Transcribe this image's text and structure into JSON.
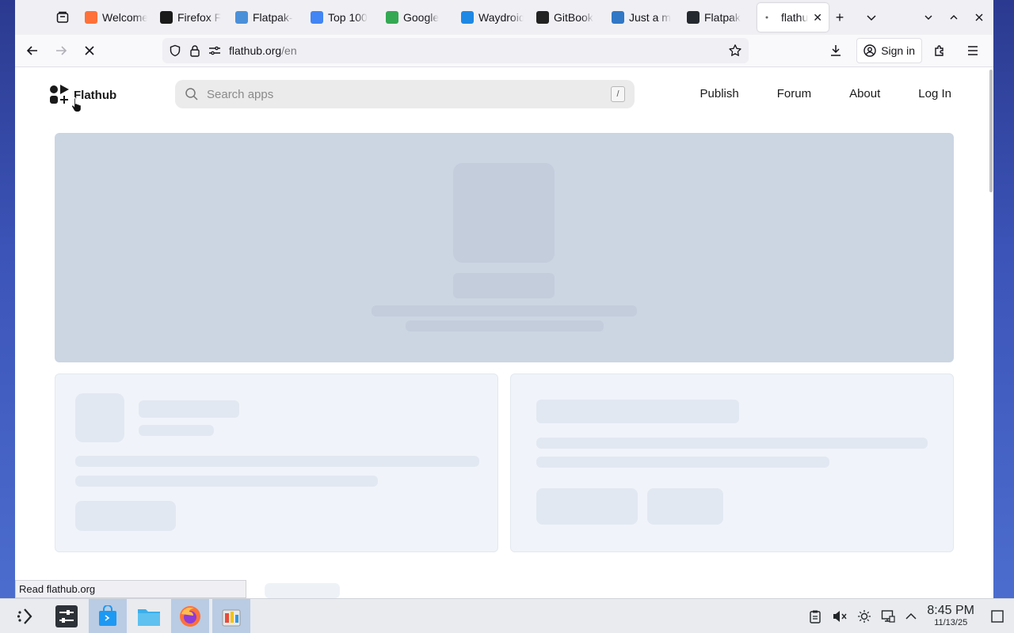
{
  "browser": {
    "tabs": [
      {
        "label": "Welcome",
        "favicon": "firefox-icon",
        "color": "#ff7139"
      },
      {
        "label": "Firefox F",
        "favicon": "terminal-icon",
        "color": "#1a1a1a"
      },
      {
        "label": "Flatpak-",
        "favicon": "flatpak-icon",
        "color": "#4a90d9"
      },
      {
        "label": "Top 100",
        "favicon": "google-g-icon",
        "color": "#4285f4"
      },
      {
        "label": "Google",
        "favicon": "chrome-icon",
        "color": "#34a853"
      },
      {
        "label": "Waydroid",
        "favicon": "waydroid-icon",
        "color": "#1e88e5"
      },
      {
        "label": "GitBook",
        "favicon": "gitbook-icon",
        "color": "#222"
      },
      {
        "label": "Just a m",
        "favicon": "ts-icon",
        "color": "#3178c6"
      },
      {
        "label": "Flatpak",
        "favicon": "github-icon",
        "color": "#24292f"
      },
      {
        "label": "flathu",
        "favicon": "loading-icon",
        "color": "#666",
        "active": true
      }
    ],
    "url_host": "flathub.org",
    "url_path": "/en",
    "signin_label": "Sign in",
    "status_text": "Read flathub.org"
  },
  "site": {
    "logo_text": "Flathub",
    "search_placeholder": "Search apps",
    "search_shortcut": "/",
    "nav": [
      "Publish",
      "Forum",
      "About",
      "Log In"
    ]
  },
  "taskbar": {
    "time": "8:45 PM",
    "date": "11/13/25"
  }
}
